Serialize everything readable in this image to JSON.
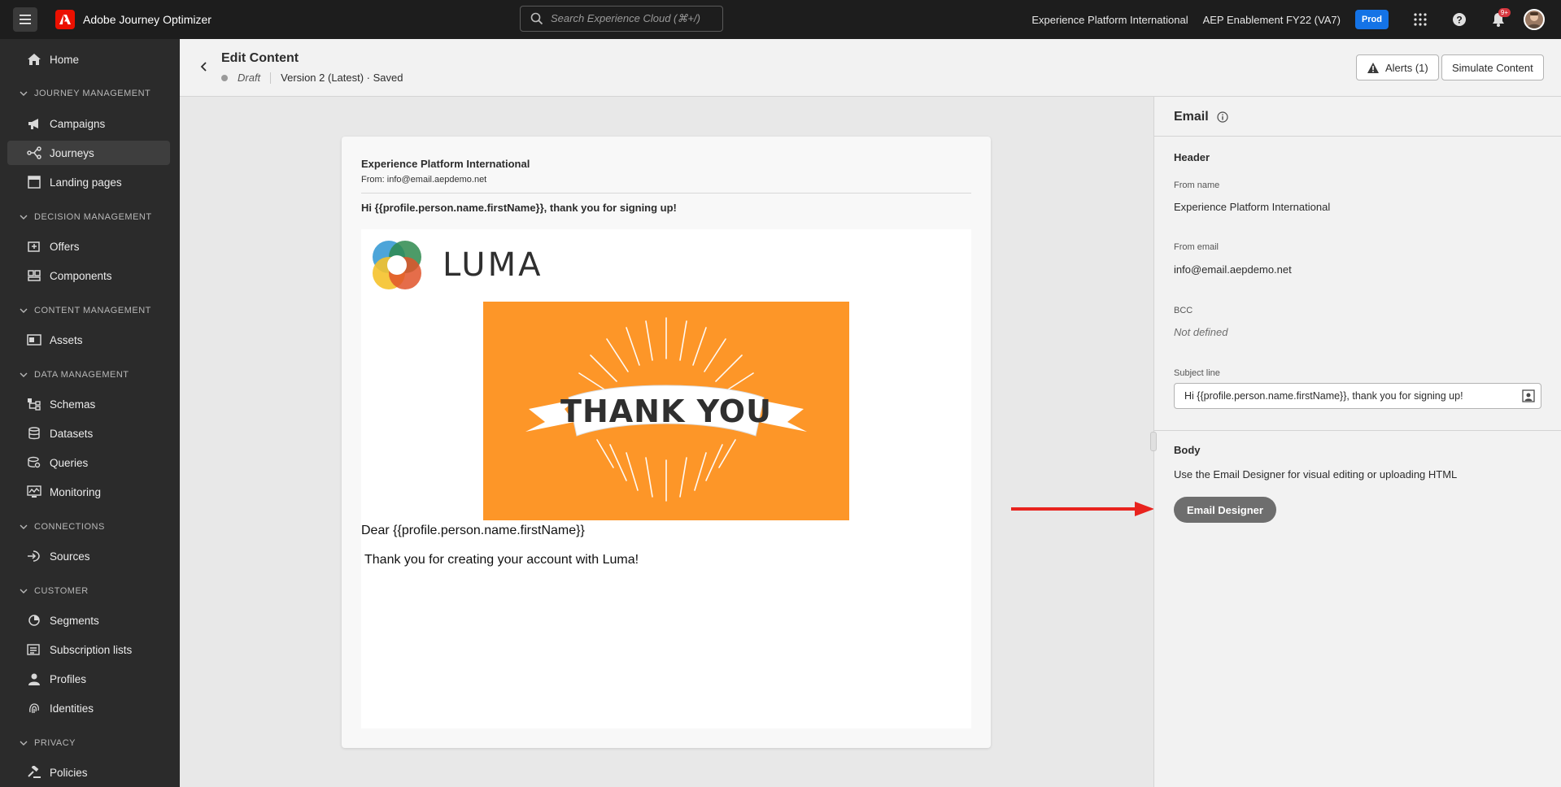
{
  "topbar": {
    "app_name": "Adobe Journey Optimizer",
    "search_placeholder": "Search Experience Cloud (⌘+/)",
    "org": "Experience Platform International",
    "sandbox": "AEP Enablement FY22 (VA7)",
    "env_badge": "Prod",
    "notification_count": "9+"
  },
  "sidebar": {
    "home": "Home",
    "journey_management": "JOURNEY MANAGEMENT",
    "campaigns": "Campaigns",
    "journeys": "Journeys",
    "landing_pages": "Landing pages",
    "decision_management": "DECISION MANAGEMENT",
    "offers": "Offers",
    "components": "Components",
    "content_management": "CONTENT MANAGEMENT",
    "assets": "Assets",
    "data_management": "DATA MANAGEMENT",
    "schemas": "Schemas",
    "datasets": "Datasets",
    "queries": "Queries",
    "monitoring": "Monitoring",
    "connections": "CONNECTIONS",
    "sources": "Sources",
    "customer": "CUSTOMER",
    "segments": "Segments",
    "subscription_lists": "Subscription lists",
    "profiles": "Profiles",
    "identities": "Identities",
    "privacy": "PRIVACY",
    "policies": "Policies"
  },
  "header": {
    "title": "Edit Content",
    "status": "Draft",
    "version": "Version 2 (Latest) · Saved",
    "alerts_label": "Alerts (1)",
    "simulate_label": "Simulate Content"
  },
  "email_preview": {
    "sender_name": "Experience Platform International",
    "from_line": "From: info@email.aepdemo.net",
    "subject": "Hi {{profile.person.name.firstName}}, thank you for signing up!",
    "logo_text": "LUMA",
    "banner_text": "THANK YOU",
    "greeting": "Dear {{profile.person.name.firstName}}",
    "body_text": "Thank you for creating your account with Luma!"
  },
  "panel": {
    "title": "Email",
    "header_section": "Header",
    "from_name_label": "From name",
    "from_name_value": "Experience Platform International",
    "from_email_label": "From email",
    "from_email_value": "info@email.aepdemo.net",
    "bcc_label": "BCC",
    "bcc_value": "Not defined",
    "subject_label": "Subject line",
    "subject_value": "Hi {{profile.person.name.firstName}}, thank you for signing up!",
    "body_section": "Body",
    "body_desc": "Use the Email Designer for visual editing or uploading HTML",
    "email_designer_label": "Email Designer"
  },
  "colors": {
    "accent": "#1473e6",
    "banner_orange": "#fd9628",
    "arrow_red": "#e8231e"
  }
}
